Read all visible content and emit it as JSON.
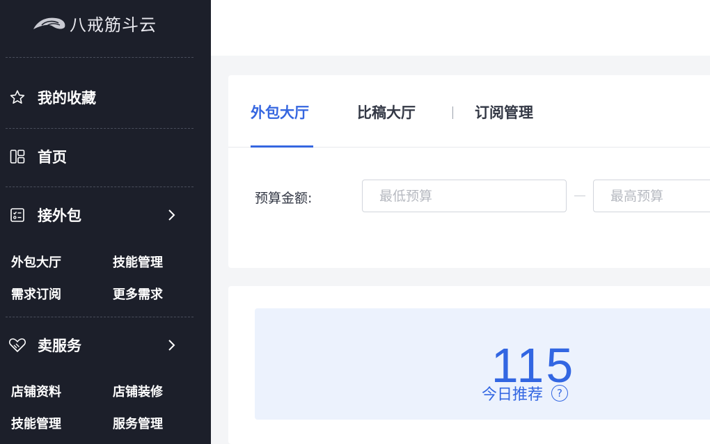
{
  "brand": {
    "name": "八戒筋斗云"
  },
  "sidebar": {
    "favorites": {
      "label": "我的收藏",
      "icon": "star-icon"
    },
    "home": {
      "label": "首页",
      "icon": "grid-icon"
    },
    "outsourcing": {
      "label": "接外包",
      "icon": "task-list-icon",
      "items": [
        "外包大厅",
        "技能管理",
        "需求订阅",
        "更多需求"
      ]
    },
    "services": {
      "label": "卖服务",
      "icon": "handshake-icon",
      "items": [
        "店铺资料",
        "店铺装修",
        "技能管理",
        "服务管理"
      ]
    }
  },
  "main": {
    "tabs": [
      {
        "label": "外包大厅",
        "active": true
      },
      {
        "label": "比稿大厅",
        "active": false
      },
      {
        "label": "订阅管理",
        "active": false
      }
    ],
    "filter": {
      "budget_label": "预算金额:",
      "min_placeholder": "最低预算",
      "max_placeholder": "最高预算"
    },
    "stats": {
      "count": "115",
      "label": "今日推荐",
      "help_icon": "?"
    }
  },
  "colors": {
    "sidebar_bg": "#1c1f2a",
    "accent": "#3566e0",
    "stat_bg": "#ecf2fd"
  }
}
